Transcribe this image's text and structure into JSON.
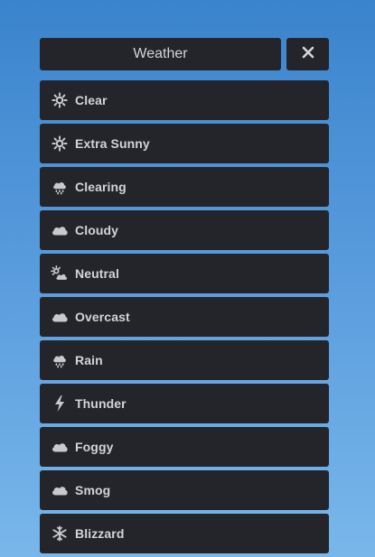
{
  "header": {
    "title": "Weather",
    "close_label": "✕"
  },
  "colors": {
    "panel_bg": "#23252b",
    "text": "#d2d4d9",
    "icon": "#c7c9ce",
    "background_top": "#3a84cd",
    "background_bottom": "#79b7ea"
  },
  "items": [
    {
      "label": "Clear",
      "icon": "sun-icon"
    },
    {
      "label": "Extra Sunny",
      "icon": "sun-icon"
    },
    {
      "label": "Clearing",
      "icon": "cloud-rain-icon"
    },
    {
      "label": "Cloudy",
      "icon": "cloud-icon"
    },
    {
      "label": "Neutral",
      "icon": "cloud-sun-icon"
    },
    {
      "label": "Overcast",
      "icon": "cloud-icon"
    },
    {
      "label": "Rain",
      "icon": "cloud-rain-icon"
    },
    {
      "label": "Thunder",
      "icon": "bolt-icon"
    },
    {
      "label": "Foggy",
      "icon": "cloud-icon"
    },
    {
      "label": "Smog",
      "icon": "cloud-icon"
    },
    {
      "label": "Blizzard",
      "icon": "snowflake-icon"
    }
  ]
}
